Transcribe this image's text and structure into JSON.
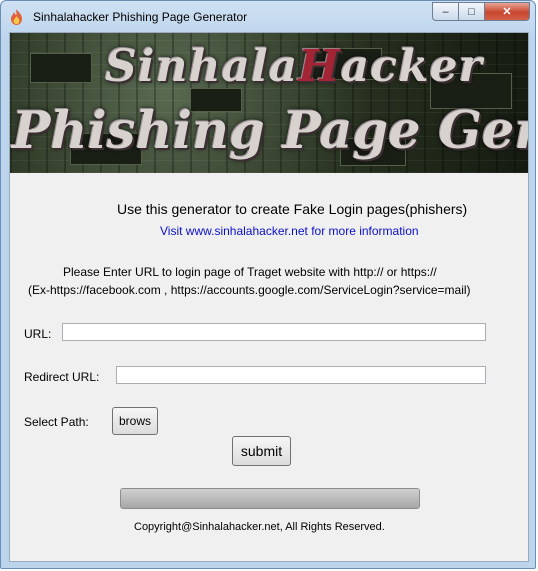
{
  "window": {
    "title": "Sinhalahacker Phishing Page Generator",
    "controls": {
      "minimize": "–",
      "maximize": "□",
      "close": "✕"
    }
  },
  "banner": {
    "line1_part1": "Sinhala",
    "line1_accent": "H",
    "line1_part2": "acker",
    "line2": "Phishing Page Generator",
    "colors": {
      "text": "#d8d2cf",
      "accent": "#a32535",
      "background": "#27301f"
    }
  },
  "main": {
    "headline": "Use this generator to create Fake Login pages(phishers)",
    "info_link": "Visit www.sinhalahacker.net for more information",
    "instruction_line1": "Please Enter URL to login page of Traget website with http:// or https://",
    "instruction_line2": "(Ex-https://facebook.com , https://accounts.google.com/ServiceLogin?service=mail)"
  },
  "form": {
    "url_label": "URL:",
    "url_value": "",
    "redirect_label": "Redirect URL:",
    "redirect_value": "",
    "path_label": "Select Path:",
    "browse_button": "brows",
    "submit_button": "submit"
  },
  "progress": {
    "value": 1.0
  },
  "footer": {
    "copyright": "Copyright@Sinhalahacker.net, All Rights Reserved."
  },
  "icons": {
    "app": "flame-icon"
  }
}
